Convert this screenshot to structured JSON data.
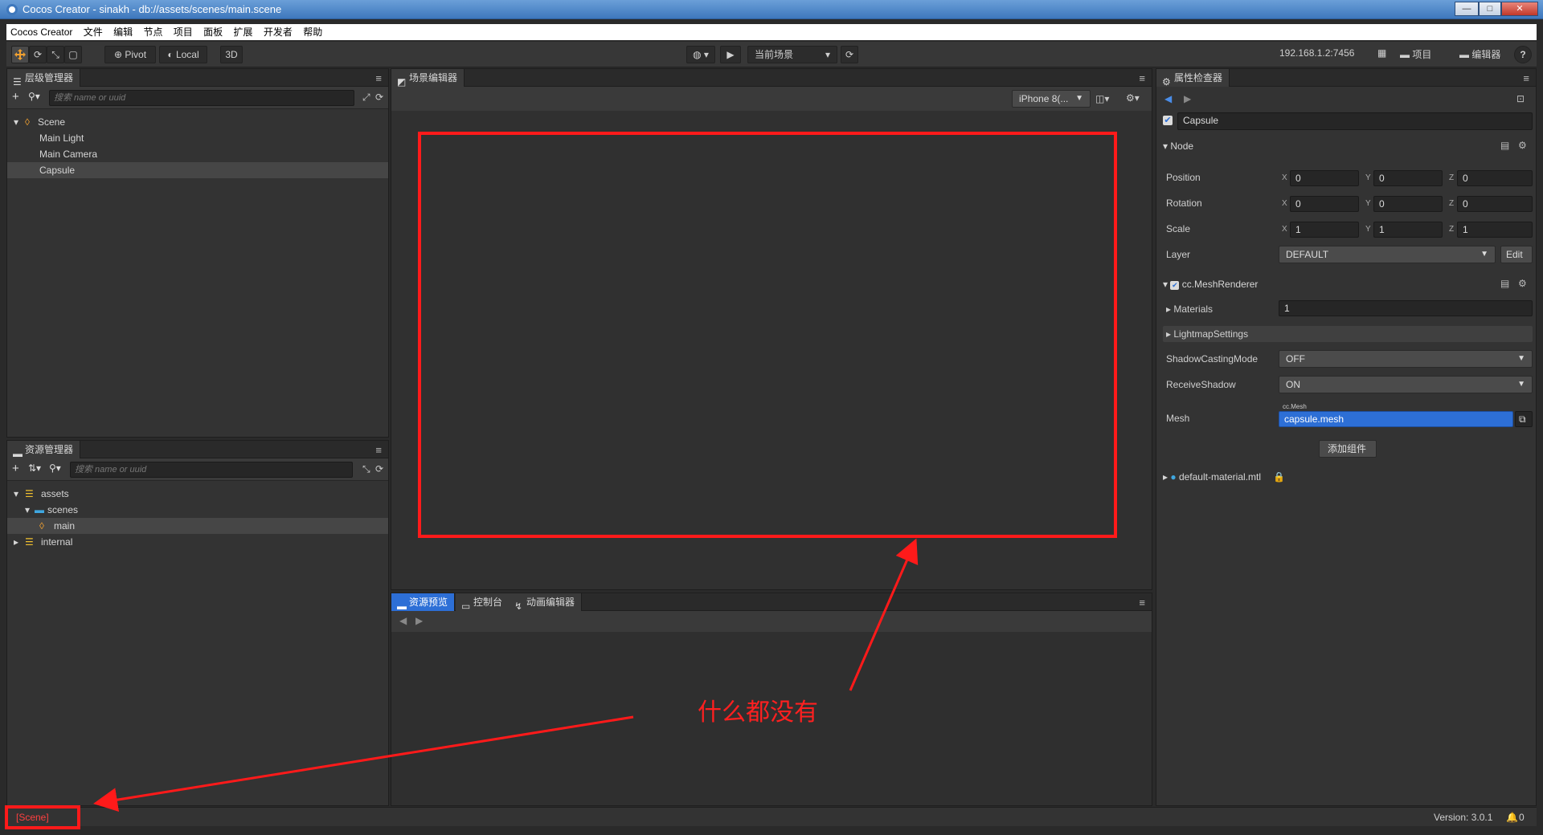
{
  "window": {
    "title": "Cocos Creator - sinakh - db://assets/scenes/main.scene",
    "minimize": "—",
    "maximize": "□",
    "close": "✕"
  },
  "menu": [
    "Cocos Creator",
    "文件",
    "编辑",
    "节点",
    "项目",
    "面板",
    "扩展",
    "开发者",
    "帮助"
  ],
  "toolbar": {
    "pivot_label": "Pivot",
    "local_label": "Local",
    "mode_3d": "3D",
    "scene_select": "当前场景",
    "ip_address": "192.168.1.2:7456",
    "project_label": "项目",
    "editor_label": "编辑器",
    "help_label": "?"
  },
  "hierarchy": {
    "tab": "层级管理器",
    "search_placeholder": "搜索 name or uuid",
    "items": [
      "Scene",
      "Main Light",
      "Main Camera",
      "Capsule"
    ]
  },
  "assets": {
    "tab": "资源管理器",
    "search_placeholder": "搜索 name or uuid",
    "items": [
      "assets",
      "scenes",
      "main",
      "internal"
    ]
  },
  "scene_editor": {
    "tab": "场景编辑器",
    "device_select": "iPhone 8(..."
  },
  "bottom_panel": {
    "tabs": [
      "资源预览",
      "控制台",
      "动画编辑器"
    ]
  },
  "inspector": {
    "tab": "属性检查器",
    "node_name": "Capsule",
    "node_section": "Node",
    "position_label": "Position",
    "rotation_label": "Rotation",
    "scale_label": "Scale",
    "layer_label": "Layer",
    "axes": [
      "X",
      "Y",
      "Z"
    ],
    "position": [
      "0",
      "0",
      "0"
    ],
    "rotation": [
      "0",
      "0",
      "0"
    ],
    "scale": [
      "1",
      "1",
      "1"
    ],
    "layer_value": "DEFAULT",
    "edit_button": "Edit",
    "mesh_renderer": "cc.MeshRenderer",
    "materials_label": "Materials",
    "materials_value": "1",
    "lightmap_label": "LightmapSettings",
    "shadow_casting_label": "ShadowCastingMode",
    "shadow_casting_value": "OFF",
    "receive_shadow_label": "ReceiveShadow",
    "receive_shadow_value": "ON",
    "mesh_label": "Mesh",
    "mesh_type": "cc.Mesh",
    "mesh_value": "capsule.mesh",
    "add_component": "添加组件",
    "material_asset": "default-material.mtl"
  },
  "status": {
    "scene_tag": "[Scene]",
    "version": "Version: 3.0.1",
    "notifications": "0"
  },
  "annotation": {
    "text": "什么都没有"
  },
  "colors": {
    "annotation_red": "#ff1a1a",
    "selection_blue": "#2d6fd6",
    "panel_bg": "#333333"
  }
}
